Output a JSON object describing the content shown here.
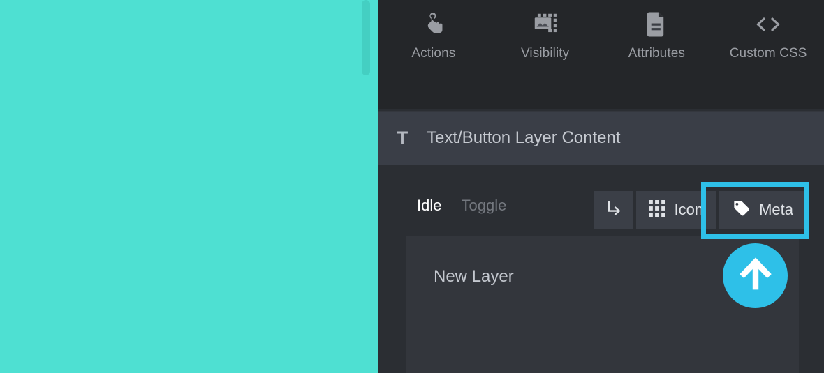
{
  "canvas": {
    "background_color": "#4ee0d2",
    "scrollbar": {
      "name": "vertical-scrollbar",
      "thumb_color": "#44cfc2"
    }
  },
  "toolbar": {
    "items": [
      {
        "label": "Actions",
        "icon": "touch-hand-icon"
      },
      {
        "label": "Visibility",
        "icon": "image-dashed-frame-icon"
      },
      {
        "label": "Attributes",
        "icon": "document-lines-icon"
      },
      {
        "label": "Custom CSS",
        "icon": "code-brackets-icon"
      }
    ]
  },
  "section": {
    "icon": "text-T-icon",
    "icon_glyph": "T",
    "title": "Text/Button Layer Content"
  },
  "states": {
    "tabs": [
      {
        "label": "Idle",
        "active": true
      },
      {
        "label": "Toggle",
        "active": false
      }
    ]
  },
  "actions": {
    "buttons": [
      {
        "label": "",
        "icon": "subdirectory-arrow-right-icon",
        "icon_only": true
      },
      {
        "label": "Icon",
        "icon": "grid-3x3-icon",
        "icon_only": false
      },
      {
        "label": "Meta",
        "icon": "tag-icon",
        "icon_only": false,
        "highlighted": true
      }
    ]
  },
  "content": {
    "value": "New Layer",
    "placeholder": "New Layer"
  },
  "overlay": {
    "highlight_color": "#2ec0e8",
    "cursor_icon": "arrow-up-icon",
    "cursor_color": "#2ec0e8"
  }
}
